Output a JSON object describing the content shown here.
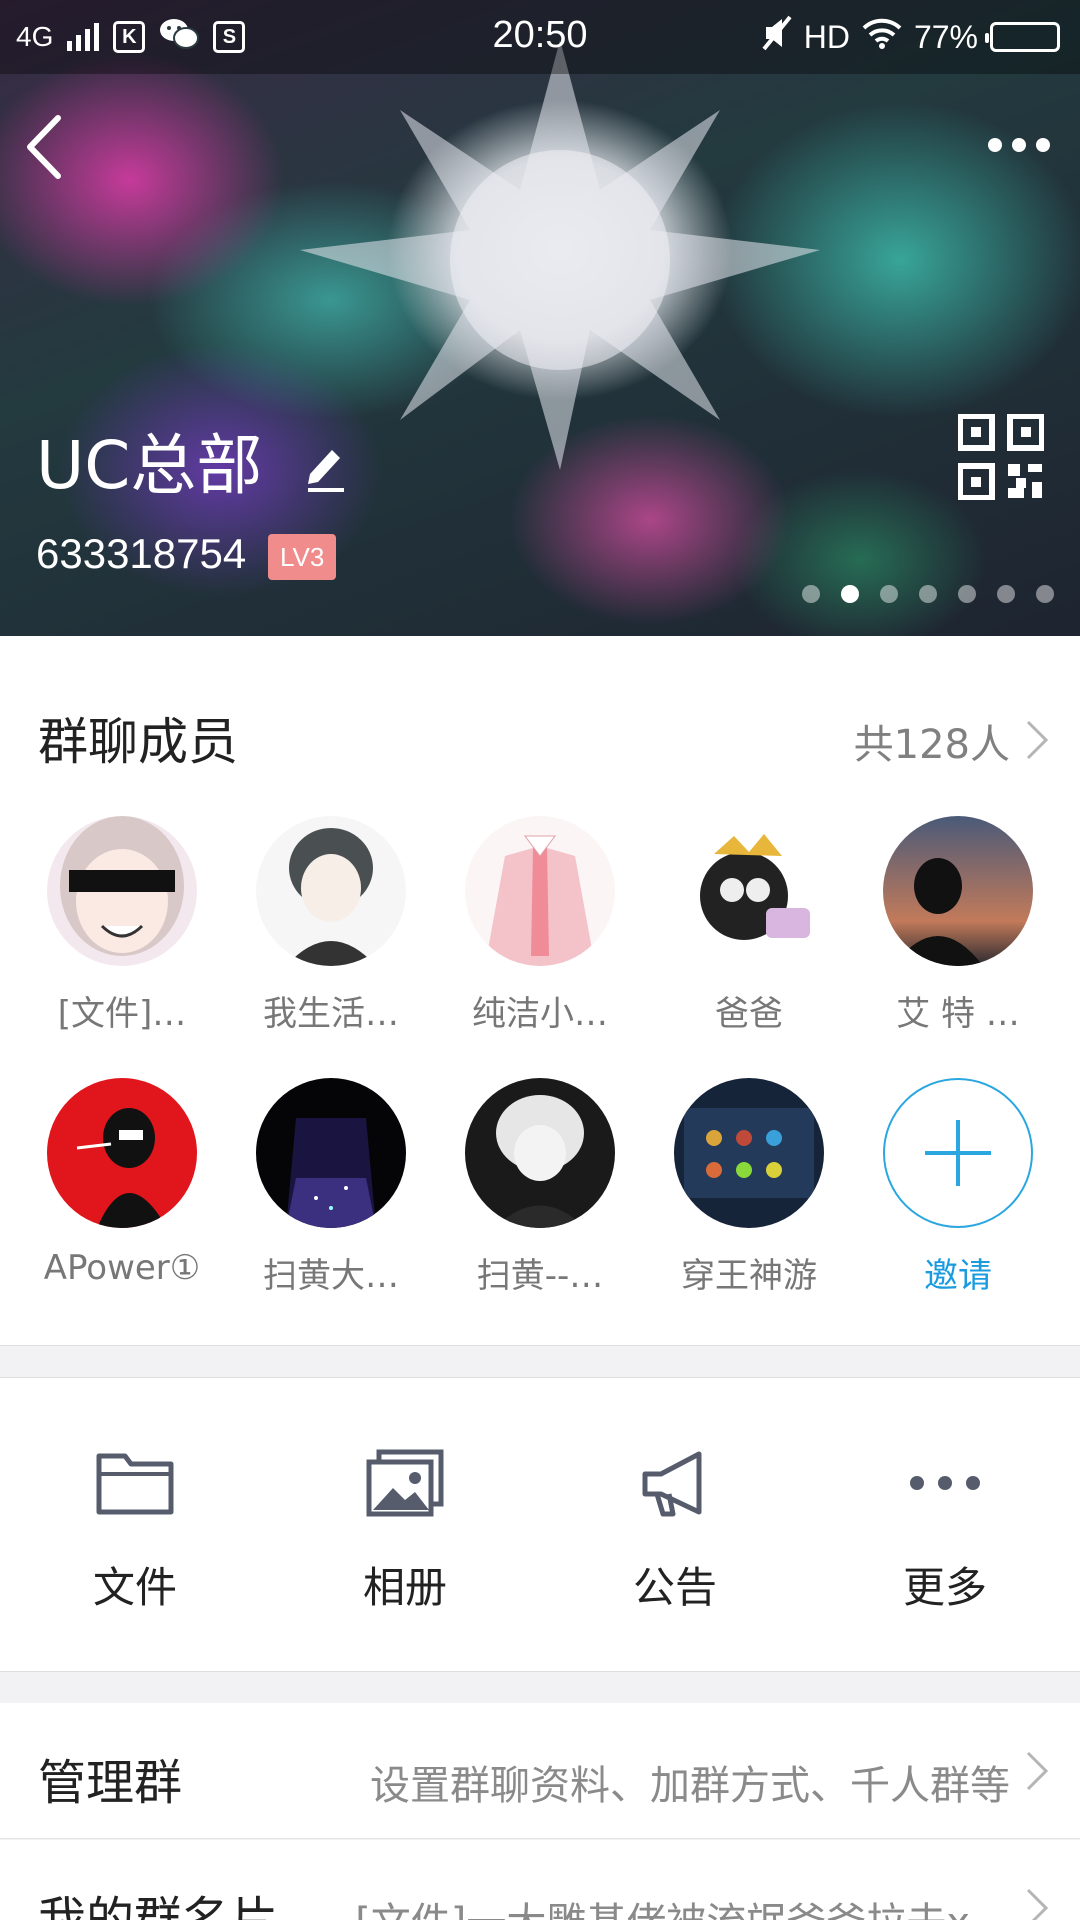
{
  "status_bar": {
    "network": "4G",
    "time": "20:50",
    "hd": "HD",
    "battery": "77%",
    "battery_level": 0.77
  },
  "header": {
    "group_name": "UC总部",
    "group_id": "633318754",
    "level": "LV3",
    "carousel_pages": 7,
    "carousel_active": 2
  },
  "members": {
    "title": "群聊成员",
    "count": "共128人",
    "list": [
      {
        "name": "[文件]…"
      },
      {
        "name": "我生活…"
      },
      {
        "name": "纯洁小…"
      },
      {
        "name": "爸爸"
      },
      {
        "name": "艾 特 …"
      },
      {
        "name": "APower①"
      },
      {
        "name": "扫黄大…"
      },
      {
        "name": "扫黄--…"
      },
      {
        "name": "穿王神游"
      }
    ],
    "invite_label": "邀请"
  },
  "actions": [
    {
      "label": "文件",
      "icon": "folder-icon"
    },
    {
      "label": "相册",
      "icon": "album-icon"
    },
    {
      "label": "公告",
      "icon": "announcement-icon"
    },
    {
      "label": "更多",
      "icon": "more-icon"
    }
  ],
  "rows": {
    "manage": {
      "title": "管理群",
      "value": "设置群聊资料、加群方式、千人群等"
    },
    "card": {
      "title": "我的群名片",
      "value": "[文件]一大雕基佬被流氓爸爸拉去x…"
    }
  },
  "colors": {
    "accent": "#1a9be0",
    "level_badge": "#f08c8c"
  }
}
